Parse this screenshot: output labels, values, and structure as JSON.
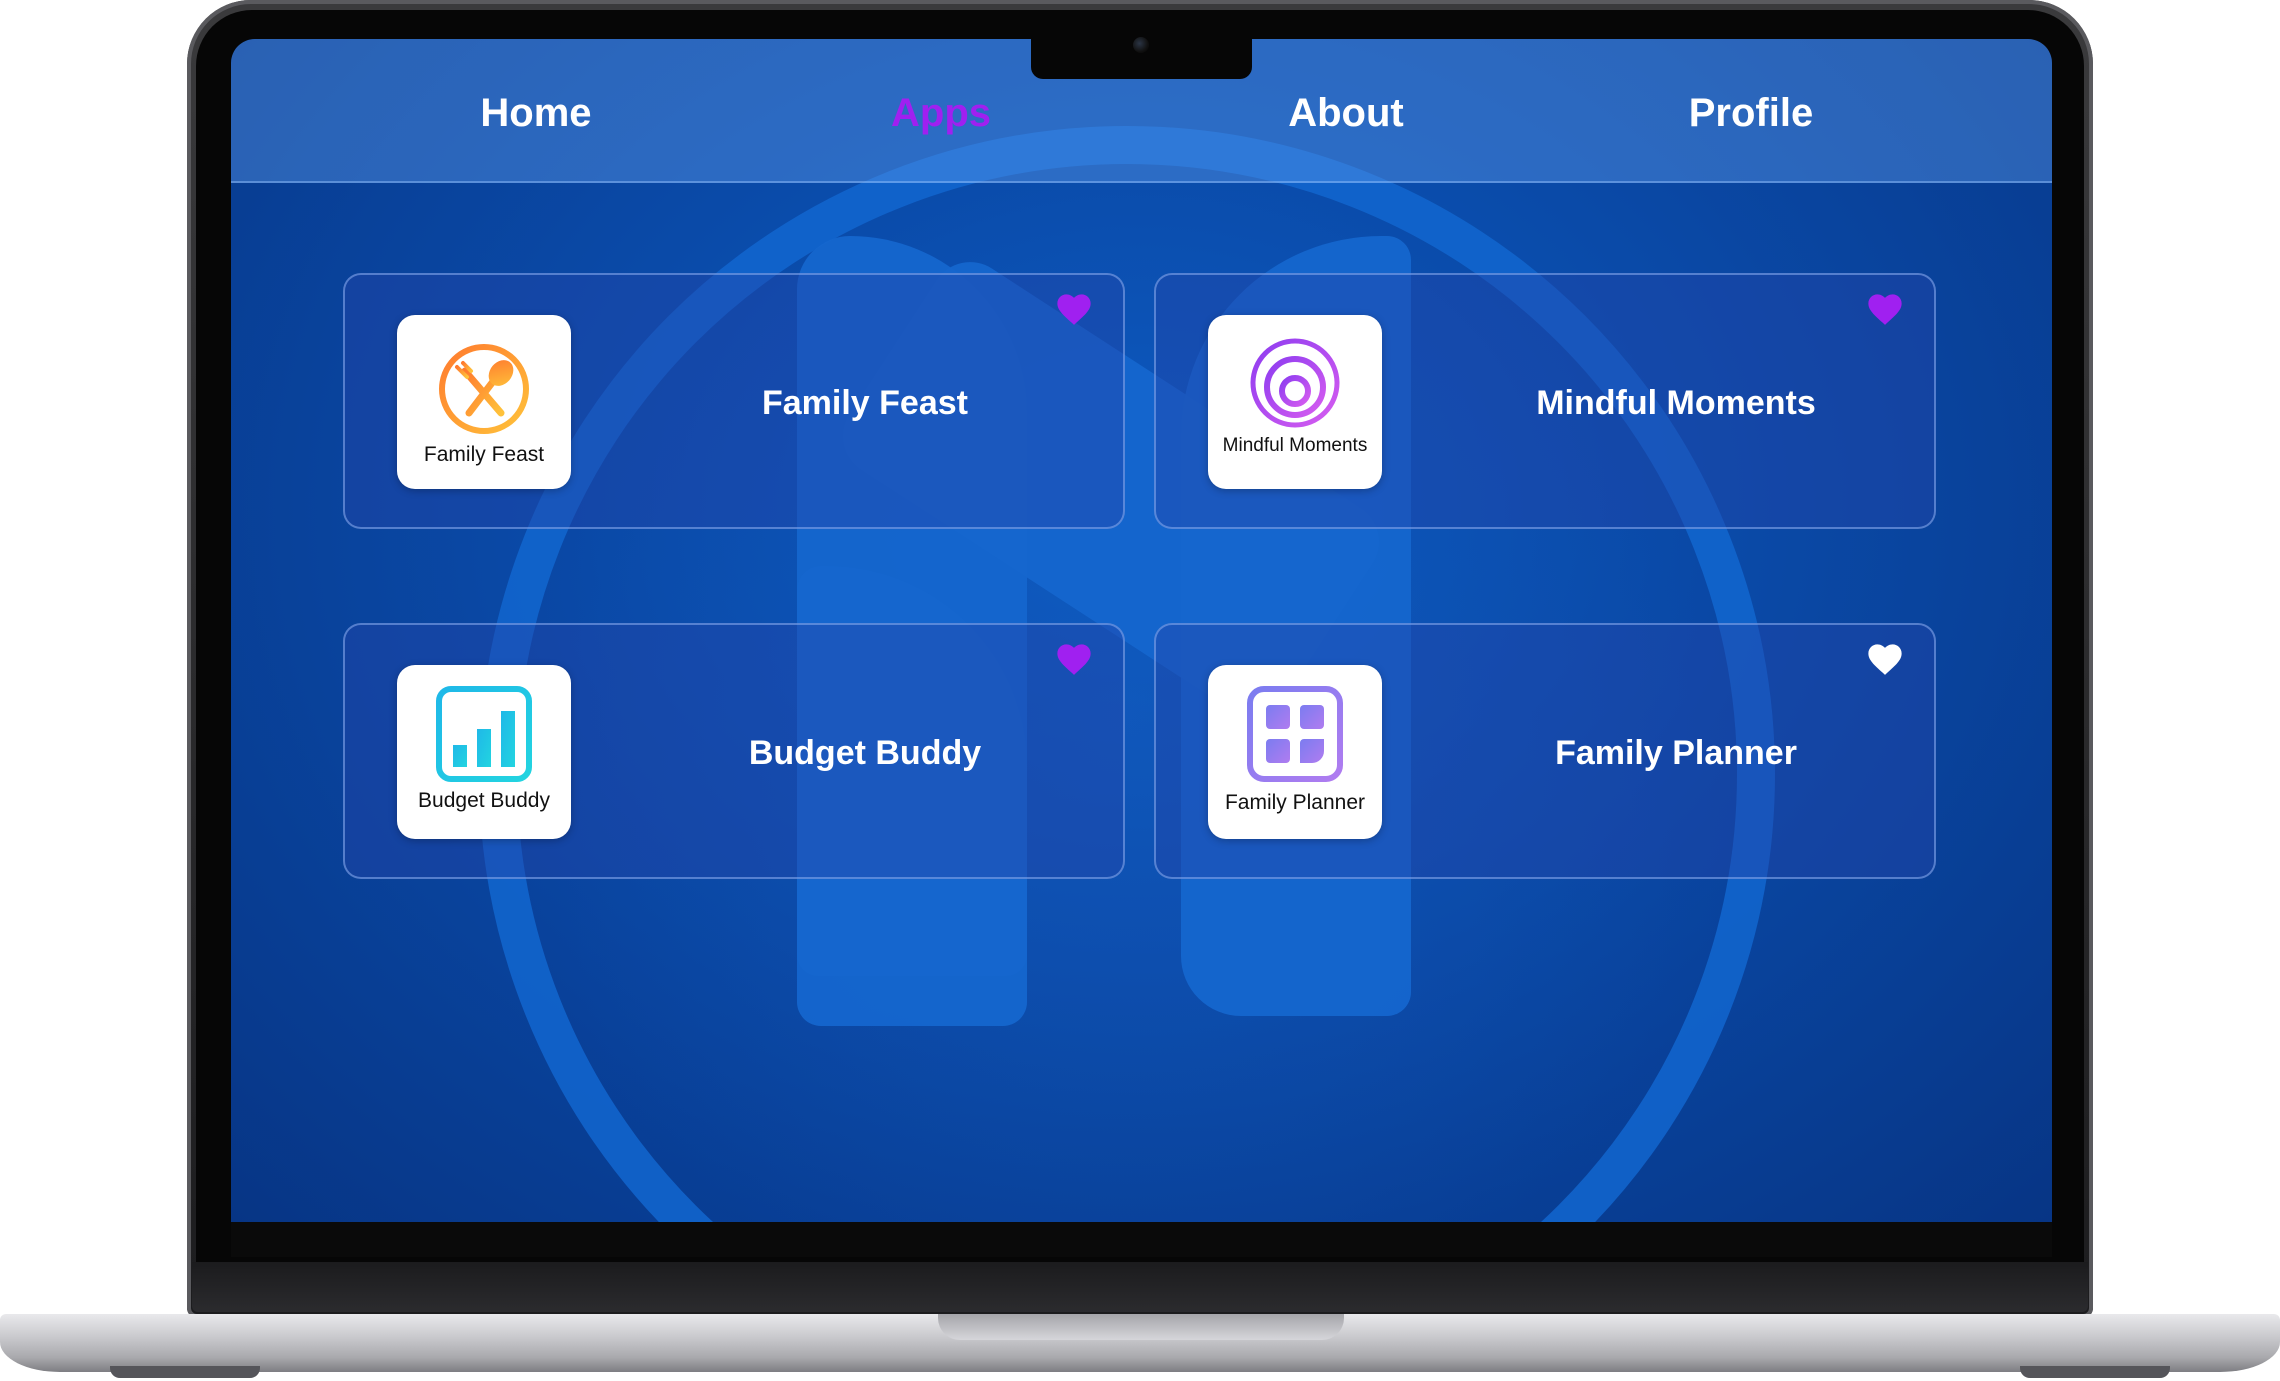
{
  "nav": {
    "items": [
      {
        "label": "Home",
        "active": false
      },
      {
        "label": "Apps",
        "active": true
      },
      {
        "label": "About",
        "active": false
      },
      {
        "label": "Profile",
        "active": false
      }
    ]
  },
  "apps": [
    {
      "title": "Family Feast",
      "icon_label": "Family Feast",
      "icon": "fork-spoon-icon",
      "favorite": true
    },
    {
      "title": "Mindful Moments",
      "icon_label": "Mindful Moments",
      "icon": "concentric-circles-icon",
      "favorite": true
    },
    {
      "title": "Budget Buddy",
      "icon_label": "Budget Buddy",
      "icon": "bar-chart-icon",
      "favorite": true
    },
    {
      "title": "Family Planner",
      "icon_label": "Family Planner",
      "icon": "grid-icon",
      "favorite": false
    }
  ],
  "colors": {
    "active_nav": "#a020f0",
    "heart_favorite": "#a020f0",
    "heart_default": "#ffffff"
  }
}
